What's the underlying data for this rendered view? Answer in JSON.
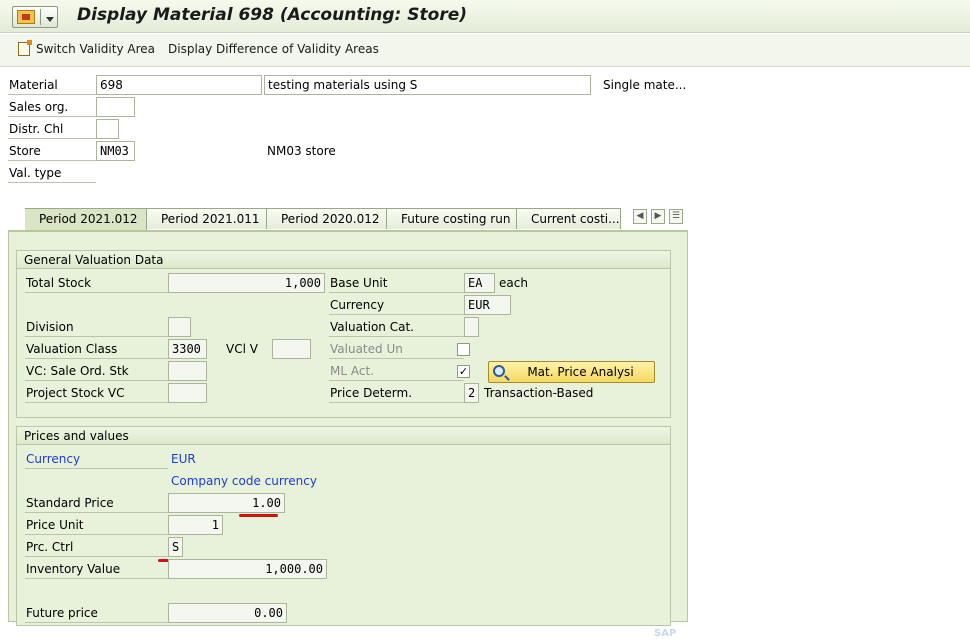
{
  "window": {
    "title": "Display Material 698 (Accounting: Store)"
  },
  "toolbar": {
    "switch_validity": "Switch Validity Area",
    "display_difference": "Display Difference of Validity Areas"
  },
  "header": {
    "material_label": "Material",
    "material_value": "698",
    "material_desc": "testing materials using S",
    "material_type": "Single mate...",
    "sales_org_label": "Sales org.",
    "sales_org_value": "",
    "distr_chl_label": "Distr. Chl",
    "distr_chl_value": "",
    "store_label": "Store",
    "store_value": "NM03",
    "store_desc": "NM03 store",
    "val_type_label": "Val. type"
  },
  "tabs": [
    {
      "label": "Period 2021.012",
      "active": true
    },
    {
      "label": "Period 2021.011",
      "active": false
    },
    {
      "label": "Period 2020.012",
      "active": false
    },
    {
      "label": "Future costing run",
      "active": false
    },
    {
      "label": "Current costi...",
      "active": false
    }
  ],
  "general": {
    "title": "General Valuation Data",
    "total_stock_label": "Total Stock",
    "total_stock_value": "1,000",
    "base_unit_label": "Base Unit",
    "base_unit_value": "EA",
    "base_unit_text": "each",
    "currency_label": "Currency",
    "currency_value": "EUR",
    "division_label": "Division",
    "division_value": "",
    "valuation_cat_label": "Valuation Cat.",
    "valuation_cat_value": "",
    "valuation_class_label": "Valuation Class",
    "valuation_class_value": "3300",
    "vcl_v_label": "VCl V",
    "vcl_v_value": "",
    "valuated_un_label": "Valuated Un",
    "valuated_un_checked": false,
    "vc_sale_label": "VC: Sale Ord. Stk",
    "vc_sale_value": "",
    "ml_act_label": "ML Act.",
    "ml_act_checked": true,
    "ml_act_mark": "✓",
    "mat_price_button": "Mat. Price Analysi",
    "project_stock_label": "Project Stock VC",
    "project_stock_value": "",
    "price_determ_label": "Price Determ.",
    "price_determ_value": "2",
    "price_determ_text": "Transaction-Based"
  },
  "prices": {
    "title": "Prices and values",
    "currency_label": "Currency",
    "currency_value": "EUR",
    "company_code_currency": "Company code currency",
    "standard_price_label": "Standard Price",
    "standard_price_value": "1.00",
    "price_unit_label": "Price Unit",
    "price_unit_value": "1",
    "prc_ctrl_label": "Prc. Ctrl",
    "prc_ctrl_value": "S",
    "inventory_value_label": "Inventory Value",
    "inventory_value_value": "1,000.00",
    "future_price_label": "Future price",
    "future_price_value": "0.00"
  },
  "colors": {
    "panel_bg": "#e8f1da",
    "link_blue": "#1a3cd0",
    "annotation_red": "#d41010",
    "button_yellow": "#f5d860"
  }
}
